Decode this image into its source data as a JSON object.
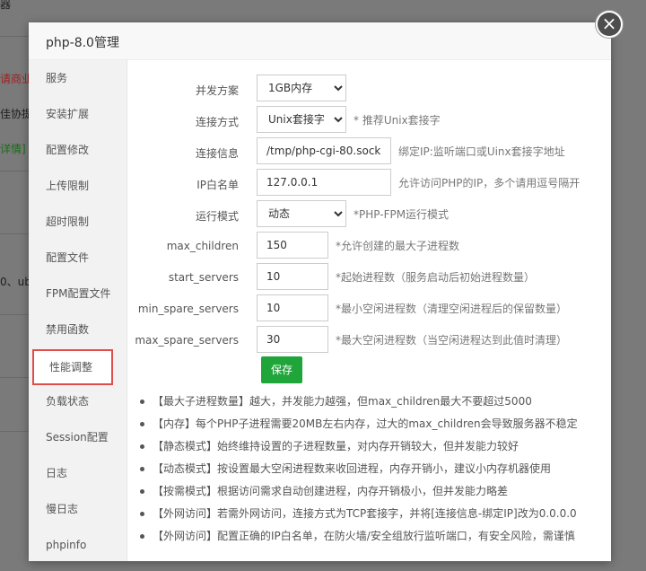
{
  "background": {
    "fragments": [
      "器",
      "请商业",
      "佳协提",
      "详情]",
      "0、ub"
    ]
  },
  "dialog": {
    "title": "php-8.0管理",
    "close_glyph": "×"
  },
  "sidebar": {
    "items": [
      {
        "label": "服务"
      },
      {
        "label": "安装扩展"
      },
      {
        "label": "配置修改"
      },
      {
        "label": "上传限制"
      },
      {
        "label": "超时限制"
      },
      {
        "label": "配置文件"
      },
      {
        "label": "FPM配置文件"
      },
      {
        "label": "禁用函数"
      },
      {
        "label": "性能调整",
        "active": true
      },
      {
        "label": "负载状态"
      },
      {
        "label": "Session配置"
      },
      {
        "label": "日志"
      },
      {
        "label": "慢日志"
      },
      {
        "label": "phpinfo"
      }
    ]
  },
  "form": {
    "concurrency": {
      "label": "并发方案",
      "value": "1GB内存"
    },
    "conn_mode": {
      "label": "连接方式",
      "value": "Unix套接字",
      "hint": "* 推荐Unix套接字"
    },
    "conn_info": {
      "label": "连接信息",
      "value": "/tmp/php-cgi-80.sock",
      "hint": "绑定IP:监听端口或Uinx套接字地址"
    },
    "ip_whitelist": {
      "label": "IP白名单",
      "value": "127.0.0.1",
      "hint": "允许访问PHP的IP，多个请用逗号隔开"
    },
    "run_mode": {
      "label": "运行模式",
      "value": "动态",
      "hint": "*PHP-FPM运行模式"
    },
    "max_children": {
      "label": "max_children",
      "value": "150",
      "hint": "*允许创建的最大子进程数"
    },
    "start_servers": {
      "label": "start_servers",
      "value": "10",
      "hint": "*起始进程数（服务启动后初始进程数量）"
    },
    "min_spare_servers": {
      "label": "min_spare_servers",
      "value": "10",
      "hint": "*最小空闲进程数（清理空闲进程后的保留数量）"
    },
    "max_spare_servers": {
      "label": "max_spare_servers",
      "value": "30",
      "hint": "*最大空闲进程数（当空闲进程达到此值时清理）"
    },
    "save_label": "保存"
  },
  "notes": [
    "【最大子进程数量】越大，并发能力越强，但max_children最大不要超过5000",
    "【内存】每个PHP子进程需要20MB左右内存，过大的max_children会导致服务器不稳定",
    "【静态模式】始终维持设置的子进程数量，对内存开销较大，但并发能力较好",
    "【动态模式】按设置最大空闲进程数来收回进程，内存开销小，建议小内存机器使用",
    "【按需模式】根据访问需求自动创建进程，内存开销极小，但并发能力略差",
    "【外网访问】若需外网访问，连接方式为TCP套接字，并将[连接信息-绑定IP]改为0.0.0.0",
    "【外网访问】配置正确的IP白名单，在防火墙/安全组放行监听端口，有安全风险，需谨慎"
  ]
}
